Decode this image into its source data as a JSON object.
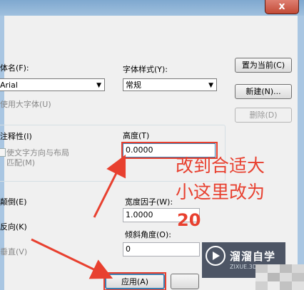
{
  "window": {
    "close_glyph": "x"
  },
  "font": {
    "name_label": "体名(F):",
    "name_value": "Arial",
    "style_label": "字体样式(Y):",
    "style_value": "常规",
    "bigfont_label": "使用大字体(U)"
  },
  "buttons": {
    "set_current": "置为当前(C)",
    "new": "新建(N)...",
    "delete": "删除(D)",
    "apply": "应用(A)"
  },
  "size": {
    "annotative_label": "注释性(I)",
    "match_orientation_label_1": "使文字方向与布局",
    "match_orientation_label_2": "匹配(M)",
    "height_label": "高度(T)",
    "height_value": "0.0000"
  },
  "effects": {
    "upside_down_label": "颠倒(E)",
    "backwards_label": "反向(K)",
    "vertical_label": "垂直(V)",
    "width_factor_label": "宽度因子(W):",
    "width_factor_value": "1.0000",
    "oblique_angle_label": "倾斜角度(O):",
    "oblique_angle_value": "0"
  },
  "annotation": {
    "line1": "改到合适大",
    "line2": "小这里改为",
    "value": "20",
    "color": "#e8402f"
  },
  "watermark": {
    "name": "溜溜自学",
    "url": "ZIXUE.3D66.COM"
  }
}
